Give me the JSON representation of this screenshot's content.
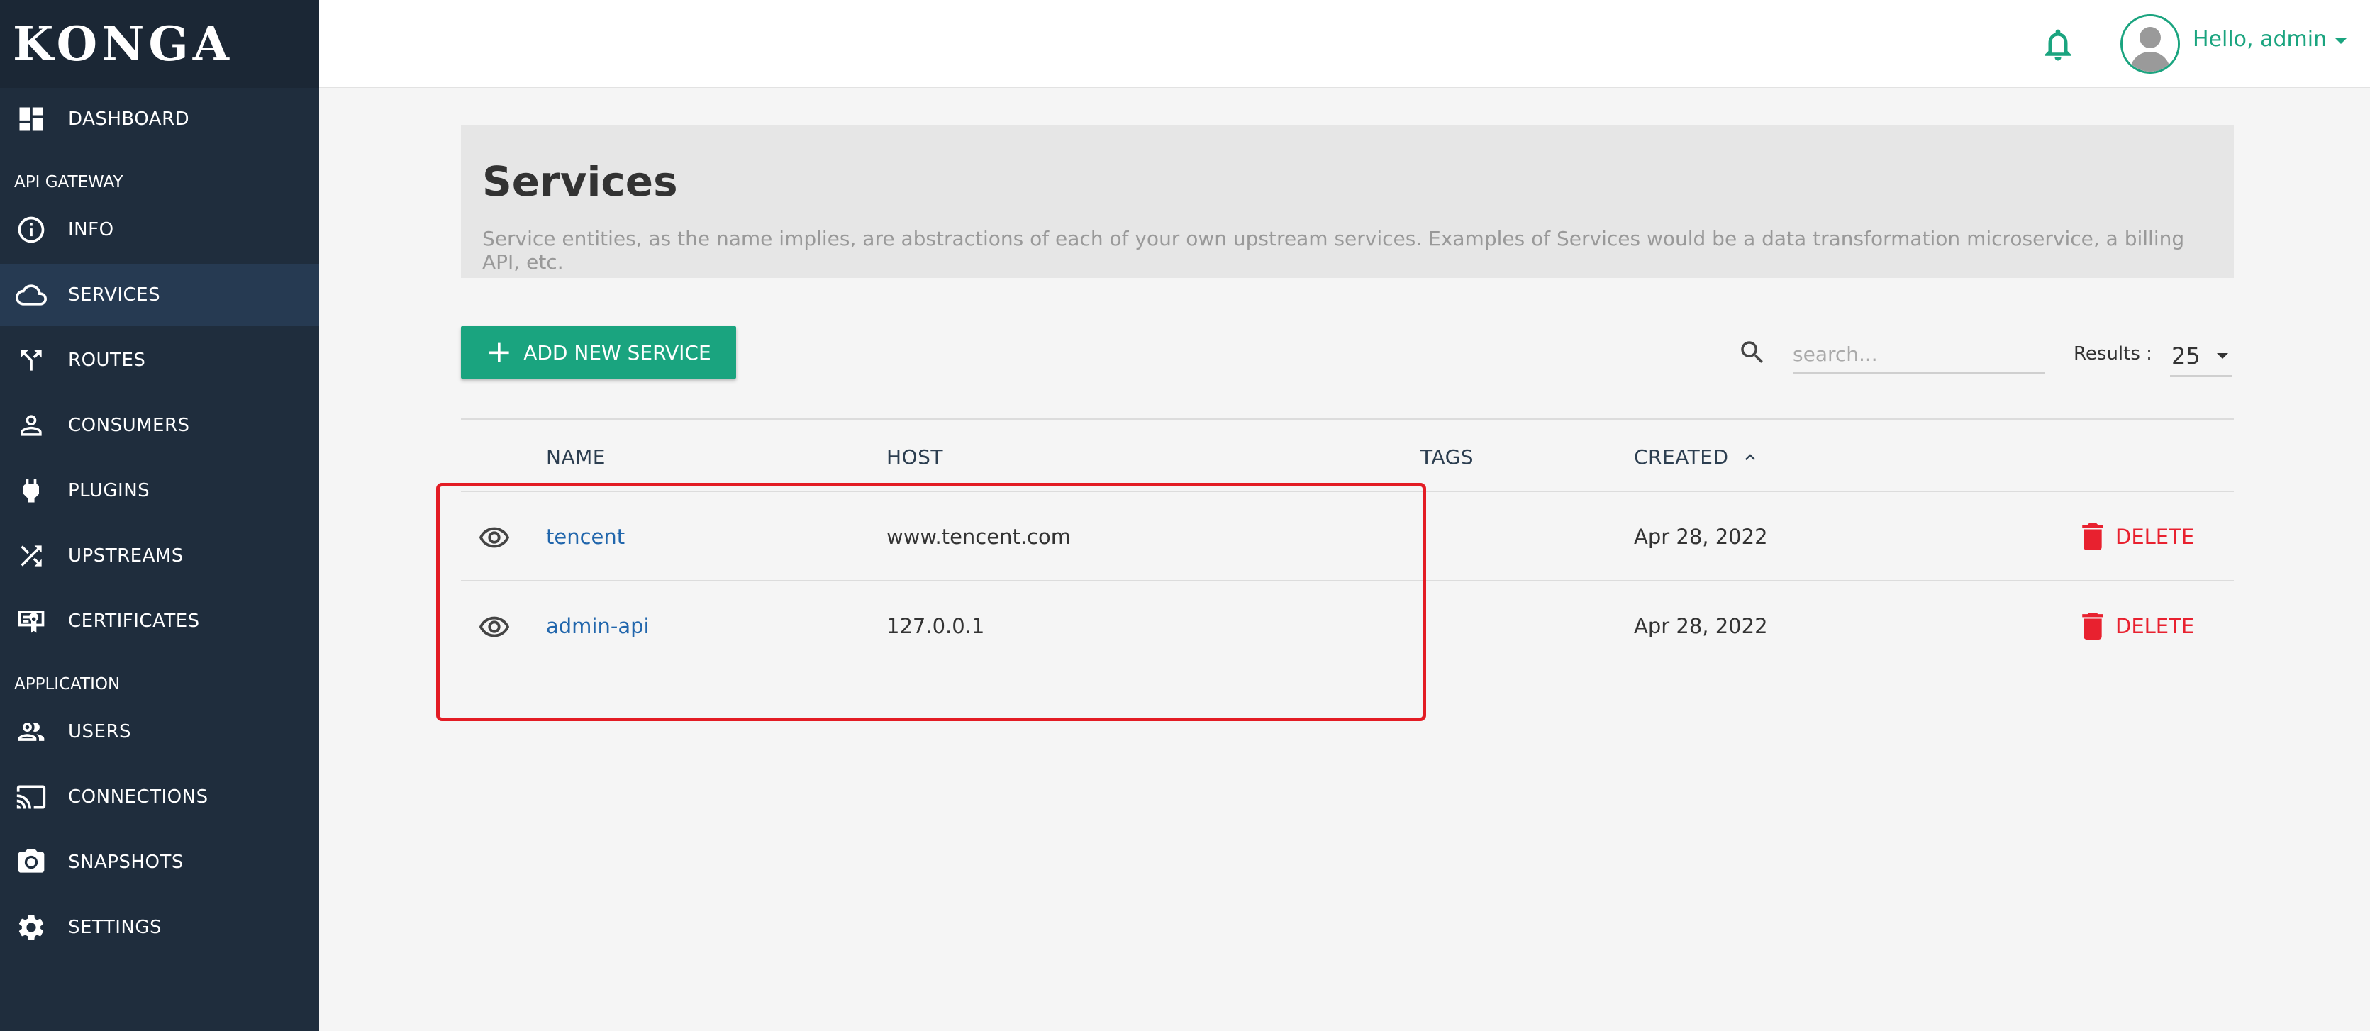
{
  "sidebar": {
    "logo": "KONGA",
    "dashboard": "DASHBOARD",
    "section_api": "API GATEWAY",
    "info": "INFO",
    "services": "SERVICES",
    "routes": "ROUTES",
    "consumers": "CONSUMERS",
    "plugins": "PLUGINS",
    "upstreams": "UPSTREAMS",
    "certificates": "CERTIFICATES",
    "section_app": "APPLICATION",
    "users": "USERS",
    "connections": "CONNECTIONS",
    "snapshots": "SNAPSHOTS",
    "settings": "SETTINGS"
  },
  "topbar": {
    "greeting": "Hello, admin"
  },
  "header": {
    "title": "Services",
    "description": "Service entities, as the name implies, are abstractions of each of your own upstream services. Examples of Services would be a data transformation microservice, a billing API, etc."
  },
  "toolbar": {
    "add_label": "ADD NEW SERVICE",
    "search_placeholder": "search...",
    "results_label": "Results :",
    "results_value": "25"
  },
  "table": {
    "columns": {
      "name": "NAME",
      "host": "HOST",
      "tags": "TAGS",
      "created": "CREATED"
    },
    "delete_label": "DELETE",
    "rows": [
      {
        "name": "tencent",
        "host": "www.tencent.com",
        "tags": "",
        "created": "Apr 28, 2022"
      },
      {
        "name": "admin-api",
        "host": "127.0.0.1",
        "tags": "",
        "created": "Apr 28, 2022"
      }
    ]
  },
  "colors": {
    "accent": "#1aa47f",
    "sidebar_bg": "#1f2d3d",
    "danger": "#e8212f",
    "link": "#2166ac"
  }
}
